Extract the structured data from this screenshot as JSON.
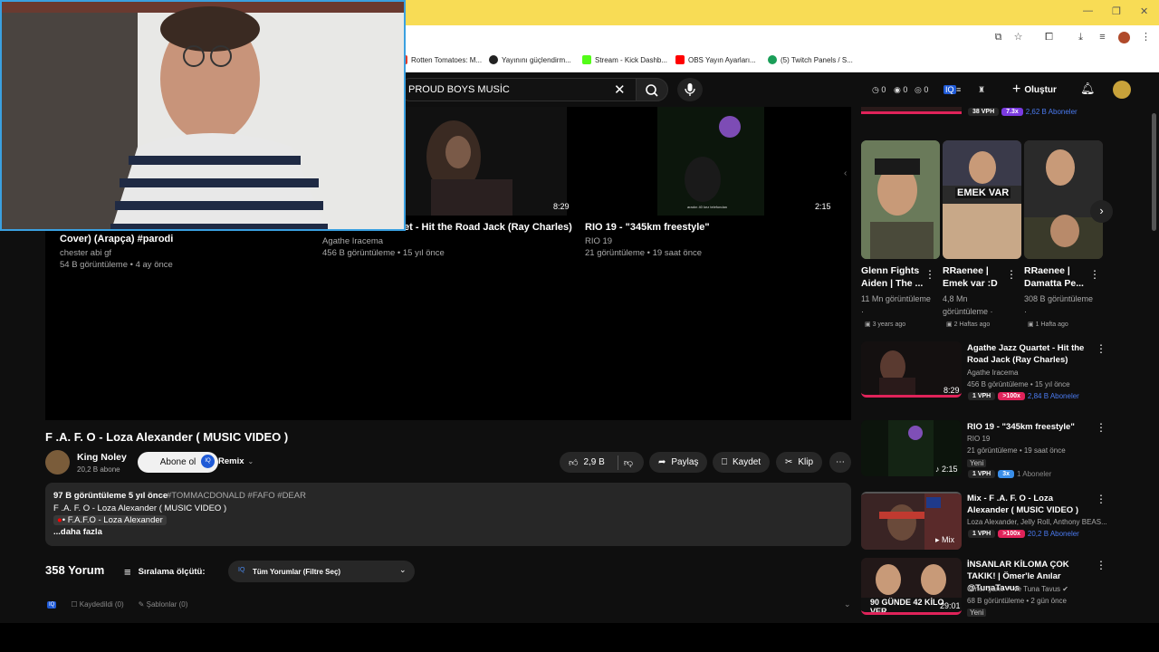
{
  "window": {
    "minimize": "—",
    "maximize": "❐",
    "close": "✕"
  },
  "bookmarks": [
    {
      "label": "Rotten Tomatoes: M...",
      "color": "#e03c2a"
    },
    {
      "label": "Yayınını güçlendirm...",
      "color": "#222222"
    },
    {
      "label": "Stream - Kick Dashb...",
      "color": "#53fc18"
    },
    {
      "label": "OBS Yayın Ayarları...",
      "color": "#ff0000"
    },
    {
      "label": "(5) Twitch Panels / S...",
      "color": "#1a9e58"
    }
  ],
  "header": {
    "search_value": "PROUD BOYS MUSİC",
    "stats": [
      "0",
      "0",
      "0"
    ],
    "create_label": "Oluştur"
  },
  "end_screen": [
    {
      "title": "Cover) (Arapça) #parodi",
      "channel": "chester abi gf",
      "meta": "54 B görüntüleme • 4 ay önce",
      "duration": ""
    },
    {
      "title": "et - Hit the Road Jack (Ray Charles)",
      "channel": "Agathe Iracema",
      "meta": "456 B görüntüleme • 15 yıl önce",
      "duration": "8:29"
    },
    {
      "title": "RIO 19 - \"345km freestyle\"",
      "channel": "RIO 19",
      "meta": "21 görüntüleme • 19 saat önce",
      "duration": "2:15"
    }
  ],
  "endcard_caption": "aradın 40 kez telefondan",
  "video": {
    "title": "F .A. F. O - Loza Alexander ( MUSIC VIDEO )",
    "channel": "King Noley",
    "subs": "20,2 B abone",
    "subscribe_label": "Abone ol",
    "remix_label": "Remix",
    "likes": "2,9 B",
    "share_label": "Paylaş",
    "save_label": "Kaydet",
    "clip_label": "Klip"
  },
  "description": {
    "views_date": "97 B görüntüleme  5 yıl önce",
    "hashtags": "#TOMMACDONALD #FAFO #DEAR",
    "line1": "F .A. F. O - Loza Alexander ( MUSIC VIDEO )",
    "chip": "• F.A.F.O - Loza Alexander",
    "more": "...daha fazla"
  },
  "comments": {
    "count_label": "358 Yorum",
    "sort_label": "Sıralama ölçütü:",
    "filter_label": "Tüm Yorumlar (Filtre Seç)",
    "saved_label": "Kaydedildi (0)",
    "templates_label": "Şablonlar (0)"
  },
  "sidebar_top_tags": {
    "vph": "38 VPH",
    "mult": "7.3x",
    "subs": "2,62 B Aboneler"
  },
  "shorts": [
    {
      "title": "Glenn Fights Aiden | The ...",
      "views": "11 Mn görüntüleme ·",
      "ago": "3 years ago"
    },
    {
      "title": "RRaenee | Emek var :D",
      "views": "4,8 Mn görüntüleme ·",
      "ago": "2 Haftas ago",
      "overlay": "EMEK VAR"
    },
    {
      "title": "RRaenee | Damatta Pe...",
      "views": "308 B görüntüleme ·",
      "ago": "1 Hafta ago"
    }
  ],
  "related": [
    {
      "title": "Agathe Jazz Quartet - Hit the Road Jack (Ray Charles)",
      "channel": "Agathe Iracema",
      "meta": "456 B görüntüleme • 15 yıl önce",
      "duration": "8:29",
      "vph": "1 VPH",
      "mult": ">100x",
      "subs": "2,84 B Aboneler",
      "mult_color": "#e0235a",
      "subs_color": "#3a6ee8"
    },
    {
      "title": "RIO 19 - \"345km freestyle\"",
      "channel": "RIO 19",
      "meta": "21 görüntüleme • 19 saat önce",
      "badge": "Yeni",
      "duration": "2:15",
      "vph": "1 VPH",
      "mult": "3x",
      "subs": "1 Aboneler",
      "mult_color": "#3a8ee8",
      "subs_color": "#888888"
    },
    {
      "title": "Mix - F .A. F. O - Loza Alexander ( MUSIC VIDEO )",
      "channel": "Loza Alexander, Jelly Roll, Anthony BEAS...",
      "meta": "",
      "duration": "Mix",
      "vph": "1 VPH",
      "mult": ">100x",
      "subs": "20,2 B Aboneler",
      "mult_color": "#e0235a",
      "subs_color": "#3a6ee8"
    },
    {
      "title": "İNSANLAR KİLOMA ÇOK TAKIK! | Ömer'le Anılar @TunaTavus",
      "channel": "Ömer Şanlı ✔ ve Tuna Tavus ✔",
      "meta": "68 B görüntüleme • 2 gün önce",
      "badge": "Yeni",
      "duration": "29:01",
      "thumb_text": "90 GÜNDE 42 KİLO VER"
    }
  ]
}
